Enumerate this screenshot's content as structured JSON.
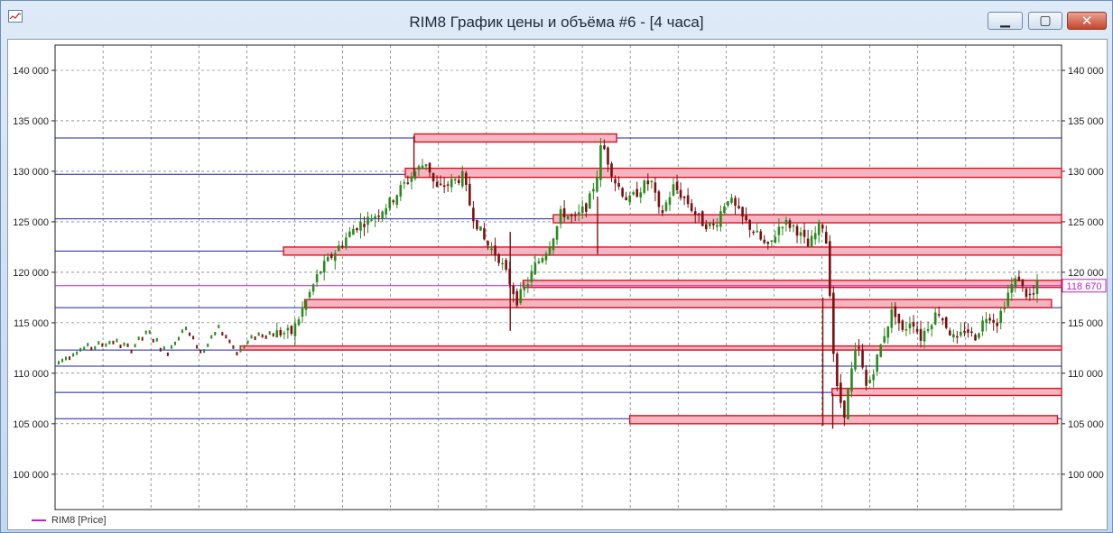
{
  "window": {
    "title": "RIM8 График цены и объёма #6 - [4 часа]",
    "minimize_glyph": "▁",
    "maximize_glyph": "▢",
    "close_glyph": "✕",
    "app_icon": "chart-window-icon"
  },
  "legend": {
    "label": "RIM8 [Price]",
    "color": "#c020c0"
  },
  "colors": {
    "up_candle": "#2a8a1e",
    "down_candle": "#7a1010",
    "horizontal_lines": "#1f1fb0",
    "zone_fill": "#f5b6c3",
    "zone_border": "#e0101e",
    "last_price_line": "#c020c0",
    "grid": "#555555"
  },
  "chart_data": {
    "type": "candlestick",
    "title": "RIM8 График цены и объёма #6 - [4 часа]",
    "series_name": "RIM8 [Price]",
    "ylim": [
      96500,
      142500
    ],
    "y_ticks": [
      {
        "value": 100000,
        "label": "100 000"
      },
      {
        "value": 105000,
        "label": "105 000"
      },
      {
        "value": 110000,
        "label": "110 000"
      },
      {
        "value": 115000,
        "label": "115 000"
      },
      {
        "value": 120000,
        "label": "120 000"
      },
      {
        "value": 125000,
        "label": "125 000"
      },
      {
        "value": 130000,
        "label": "130 000"
      },
      {
        "value": 135000,
        "label": "135 000"
      },
      {
        "value": 140000,
        "label": "140 000"
      }
    ],
    "last_price": {
      "value": 118670,
      "label": "118 670"
    },
    "horizontal_lines": [
      133300,
      129700,
      125300,
      122100,
      116500,
      112300,
      110700,
      108100,
      105500
    ],
    "zones": [
      {
        "y_low": 132900,
        "y_high": 133700,
        "x_start": 0.357,
        "x_end": 0.558
      },
      {
        "y_low": 129400,
        "y_high": 130300,
        "x_start": 0.348,
        "x_end": 1.0
      },
      {
        "y_low": 124900,
        "y_high": 125700,
        "x_start": 0.495,
        "x_end": 1.0
      },
      {
        "y_low": 121700,
        "y_high": 122500,
        "x_start": 0.227,
        "x_end": 1.0
      },
      {
        "y_low": 118500,
        "y_high": 119200,
        "x_start": 0.465,
        "x_end": 1.0
      },
      {
        "y_low": 116500,
        "y_high": 117300,
        "x_start": 0.248,
        "x_end": 0.99
      },
      {
        "y_low": 112300,
        "y_high": 112700,
        "x_start": 0.184,
        "x_end": 1.0
      },
      {
        "y_low": 107800,
        "y_high": 108500,
        "x_start": 0.772,
        "x_end": 1.0
      },
      {
        "y_low": 105000,
        "y_high": 105800,
        "x_start": 0.571,
        "x_end": 0.996
      }
    ],
    "price_path": [
      [
        0.0,
        111000
      ],
      [
        0.02,
        112300
      ],
      [
        0.04,
        112600
      ],
      [
        0.06,
        113200
      ],
      [
        0.08,
        112400
      ],
      [
        0.1,
        114000
      ],
      [
        0.12,
        112000
      ],
      [
        0.14,
        114500
      ],
      [
        0.16,
        112000
      ],
      [
        0.18,
        114500
      ],
      [
        0.2,
        112000
      ],
      [
        0.22,
        113800
      ],
      [
        0.24,
        114000
      ],
      [
        0.26,
        114000
      ],
      [
        0.27,
        116000
      ],
      [
        0.29,
        120000
      ],
      [
        0.31,
        122300
      ],
      [
        0.33,
        124500
      ],
      [
        0.35,
        125500
      ],
      [
        0.37,
        127000
      ],
      [
        0.38,
        128200
      ],
      [
        0.395,
        129800
      ],
      [
        0.41,
        131000
      ],
      [
        0.42,
        128200
      ],
      [
        0.44,
        129000
      ],
      [
        0.45,
        129500
      ],
      [
        0.46,
        126000
      ],
      [
        0.475,
        123000
      ],
      [
        0.49,
        121500
      ],
      [
        0.505,
        118500
      ],
      [
        0.51,
        117200
      ],
      [
        0.52,
        118500
      ],
      [
        0.53,
        120500
      ],
      [
        0.545,
        122500
      ],
      [
        0.555,
        124500
      ],
      [
        0.56,
        126000
      ],
      [
        0.575,
        125200
      ],
      [
        0.59,
        126800
      ],
      [
        0.6,
        129800
      ],
      [
        0.605,
        133000
      ],
      [
        0.61,
        131500
      ],
      [
        0.62,
        129000
      ],
      [
        0.635,
        127000
      ],
      [
        0.65,
        128500
      ],
      [
        0.66,
        129000
      ],
      [
        0.67,
        125500
      ],
      [
        0.685,
        128500
      ],
      [
        0.7,
        127000
      ],
      [
        0.715,
        125000
      ],
      [
        0.73,
        124500
      ],
      [
        0.745,
        127500
      ],
      [
        0.76,
        125500
      ],
      [
        0.775,
        124000
      ],
      [
        0.79,
        122300
      ],
      [
        0.805,
        125000
      ],
      [
        0.82,
        124500
      ],
      [
        0.835,
        122500
      ],
      [
        0.85,
        125000
      ],
      [
        0.855,
        123000
      ],
      [
        0.86,
        117000
      ],
      [
        0.865,
        109000
      ],
      [
        0.87,
        107500
      ],
      [
        0.875,
        106000
      ],
      [
        0.88,
        108500
      ],
      [
        0.885,
        111000
      ],
      [
        0.89,
        113000
      ],
      [
        0.895,
        110500
      ],
      [
        0.9,
        108500
      ],
      [
        0.91,
        111000
      ],
      [
        0.92,
        114000
      ],
      [
        0.93,
        116500
      ],
      [
        0.94,
        114000
      ],
      [
        0.95,
        115500
      ],
      [
        0.96,
        113500
      ],
      [
        0.97,
        115000
      ],
      [
        0.98,
        116200
      ],
      [
        0.99,
        114500
      ],
      [
        1.0,
        113000
      ],
      [
        1.01,
        114500
      ],
      [
        1.02,
        113500
      ],
      [
        1.035,
        116000
      ],
      [
        1.045,
        115000
      ],
      [
        1.06,
        118500
      ],
      [
        1.07,
        119500
      ],
      [
        1.075,
        118000
      ],
      [
        1.085,
        117500
      ],
      [
        1.09,
        118700
      ]
    ]
  }
}
